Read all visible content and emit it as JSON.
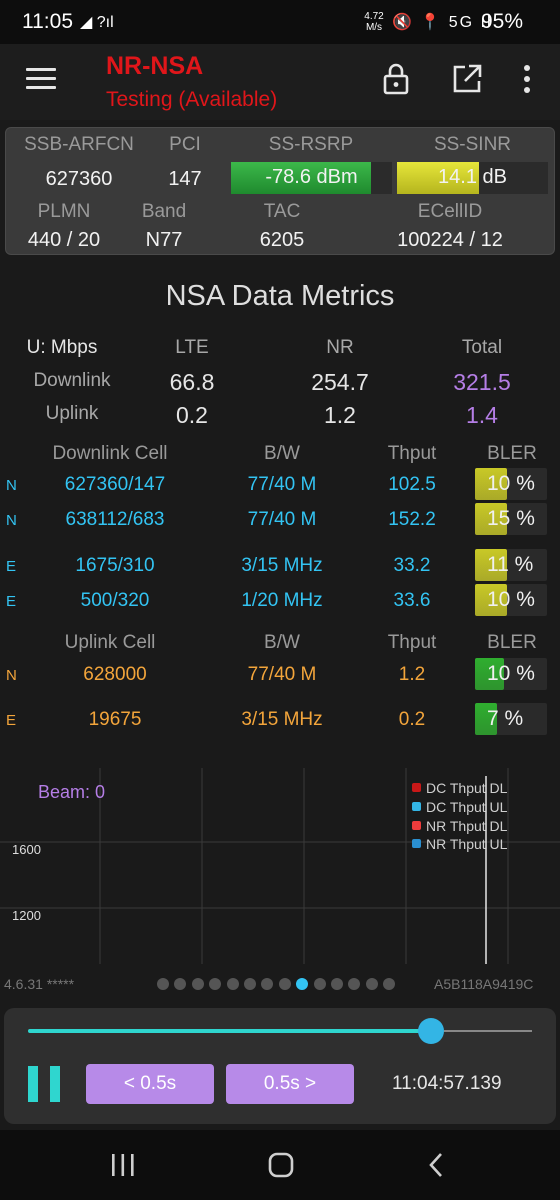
{
  "status_bar": {
    "time": "11:05",
    "left_icons": "◢ ?ıl",
    "speed_value": "4.72",
    "speed_unit": "M/s",
    "right_icons": "🔇 📍 5G ıl",
    "battery": "95%"
  },
  "app_bar": {
    "title": "NR-NSA",
    "subtitle": "Testing (Available)",
    "icons": [
      "menu-icon",
      "lock-icon",
      "open-external-icon",
      "more-vert-icon"
    ]
  },
  "info_card": {
    "ssb_arfcn_label": "SSB-ARFCN",
    "ssb_arfcn": "627360",
    "pci_label": "PCI",
    "pci": "147",
    "rsrp_label": "SS-RSRP",
    "rsrp": "-78.6 dBm",
    "rsrp_level": 0.87,
    "sinr_label": "SS-SINR",
    "sinr": "14.1 dB",
    "sinr_level": 0.54,
    "plmn_label": "PLMN",
    "plmn": "440 / 20",
    "band_label": "Band",
    "band": "N77",
    "tac_label": "TAC",
    "tac": "6205",
    "ecellid_label": "ECellID",
    "ecellid": "100224 / 12"
  },
  "metrics": {
    "title": "NSA Data Metrics",
    "unit_label": "U: Mbps",
    "col_lte": "LTE",
    "col_nr": "NR",
    "col_total": "Total",
    "downlink_label": "Downlink",
    "uplink_label": "Uplink",
    "dl_lte": "66.8",
    "dl_nr": "254.7",
    "dl_total": "321.5",
    "ul_lte": "0.2",
    "ul_nr": "1.2",
    "ul_total": "1.4"
  },
  "downlink_table": {
    "headers": [
      "Downlink Cell",
      "B/W",
      "Thput",
      "BLER"
    ],
    "rows": [
      {
        "tag": "N",
        "cell": "627360/147",
        "bw": "77/40 M",
        "thput": "102.5",
        "bler": "10 %",
        "bler_level": 0.45,
        "bler_color": "#c9c927"
      },
      {
        "tag": "N",
        "cell": "638112/683",
        "bw": "77/40 M",
        "thput": "152.2",
        "bler": "15 %",
        "bler_level": 0.45,
        "bler_color": "#c9c927"
      },
      {
        "tag": "E",
        "cell": "1675/310",
        "bw": "3/15 MHz",
        "thput": "33.2",
        "bler": "11 %",
        "bler_level": 0.45,
        "bler_color": "#c9c927"
      },
      {
        "tag": "E",
        "cell": "500/320",
        "bw": "1/20 MHz",
        "thput": "33.6",
        "bler": "10 %",
        "bler_level": 0.45,
        "bler_color": "#c9c927"
      }
    ]
  },
  "uplink_table": {
    "headers": [
      "Uplink Cell",
      "B/W",
      "Thput",
      "BLER"
    ],
    "rows": [
      {
        "tag": "N",
        "cell": "628000",
        "bw": "77/40 M",
        "thput": "1.2",
        "bler": "10 %",
        "bler_level": 0.4,
        "bler_color": "#2fae2f"
      },
      {
        "tag": "E",
        "cell": "19675",
        "bw": "3/15 MHz",
        "thput": "0.2",
        "bler": "7 %",
        "bler_level": 0.3,
        "bler_color": "#2fae2f"
      }
    ]
  },
  "chart": {
    "beam_label": "Beam: 0",
    "y_ticks": [
      "1600",
      "1200"
    ],
    "legend": [
      {
        "name": "DC Thput DL",
        "color": "#c81818"
      },
      {
        "name": "DC Thput UL",
        "color": "#33b5e5"
      },
      {
        "name": "NR Thput DL",
        "color": "#f03c3c"
      },
      {
        "name": "NR Thput UL",
        "color": "#2a8fd0"
      }
    ]
  },
  "footer": {
    "version": "4.6.31 *****",
    "device_id": "A5B118A9419C",
    "page_count": 14,
    "active_page": 8
  },
  "playback": {
    "progress": 0.8,
    "prev_label": "< 0.5s",
    "next_label": "0.5s >",
    "time": "11:04:57.139"
  },
  "nav_bar": {
    "icons": [
      "recent-apps-icon",
      "home-icon",
      "back-icon"
    ]
  }
}
